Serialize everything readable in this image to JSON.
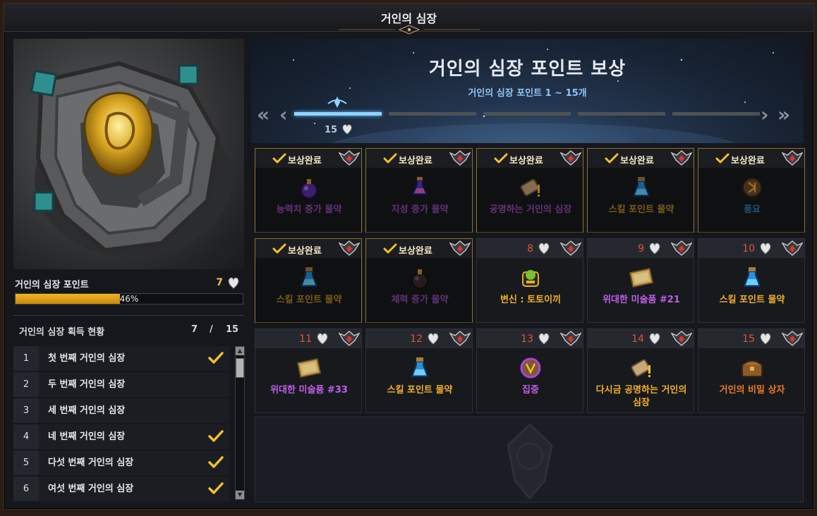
{
  "window": {
    "title": "거인의 심장"
  },
  "left": {
    "points_label": "거인의 심장 포인트",
    "points_value": "7",
    "progress_percent": 46,
    "progress_text": "46%",
    "acquisition_label": "거인의 심장 획득 현황",
    "acquired": "7",
    "slash": "/",
    "total": "15",
    "list": [
      {
        "num": "1",
        "name": "첫 번째 거인의 심장",
        "checked": true
      },
      {
        "num": "2",
        "name": "두 번째 거인의 심장",
        "checked": false
      },
      {
        "num": "3",
        "name": "세 번째 거인의 심장",
        "checked": false
      },
      {
        "num": "4",
        "name": "네 번째 거인의 심장",
        "checked": true
      },
      {
        "num": "5",
        "name": "다섯 번째 거인의 심장",
        "checked": true
      },
      {
        "num": "6",
        "name": "여섯 번째 거인의 심장",
        "checked": true
      }
    ]
  },
  "right": {
    "title": "거인의 심장 포인트 보상",
    "subtitle": "거인의 심장 포인트 1 ~ 15개",
    "page_label": "15",
    "completed_label": "보상완료",
    "rewards": [
      {
        "num": "",
        "done": true,
        "name": "능력치 증가 물약",
        "color": "purple",
        "icon": "potion-purple-icon"
      },
      {
        "num": "",
        "done": true,
        "name": "지성 증가 물약",
        "color": "purple",
        "icon": "potion-pink-icon"
      },
      {
        "num": "",
        "done": true,
        "name": "공명하는 거인의 심장",
        "color": "purple",
        "icon": "scroll-icon"
      },
      {
        "num": "",
        "done": true,
        "name": "스킬 포인트 물약",
        "color": "gold",
        "icon": "potion-blue-icon"
      },
      {
        "num": "",
        "done": true,
        "name": "풍요",
        "color": "blue",
        "icon": "rune-icon"
      },
      {
        "num": "",
        "done": true,
        "name": "스킬 포인트 물약",
        "color": "gold",
        "icon": "potion-blue-icon"
      },
      {
        "num": "",
        "done": true,
        "name": "체력 증가 물약",
        "color": "purple",
        "icon": "potion-dark-icon"
      },
      {
        "num": "8",
        "done": false,
        "name": "변신 : 토토이끼",
        "color": "gold",
        "icon": "transform-icon"
      },
      {
        "num": "9",
        "done": false,
        "name": "위대한 미술품 #21",
        "color": "purple",
        "icon": "painting-icon"
      },
      {
        "num": "10",
        "done": false,
        "name": "스킬 포인트 물약",
        "color": "gold",
        "icon": "potion-blue-icon"
      },
      {
        "num": "11",
        "done": false,
        "name": "위대한 미술품 #33",
        "color": "purple",
        "icon": "painting-icon"
      },
      {
        "num": "12",
        "done": false,
        "name": "스킬 포인트 물약",
        "color": "gold",
        "icon": "potion-blue-icon"
      },
      {
        "num": "13",
        "done": false,
        "name": "집중",
        "color": "purple",
        "icon": "rune-purple-icon"
      },
      {
        "num": "14",
        "done": false,
        "name": "다시금 공명하는 거인의 심장",
        "color": "gold",
        "icon": "scroll-icon"
      },
      {
        "num": "15",
        "done": false,
        "name": "거인의 비밀 상자",
        "color": "orange",
        "icon": "chest-icon"
      }
    ]
  },
  "colors": {
    "accent_gold": "#f0c23a",
    "progress_fill": "#f2b520",
    "number_red": "#e0533a",
    "banner_blue": "#8fc6f5"
  }
}
